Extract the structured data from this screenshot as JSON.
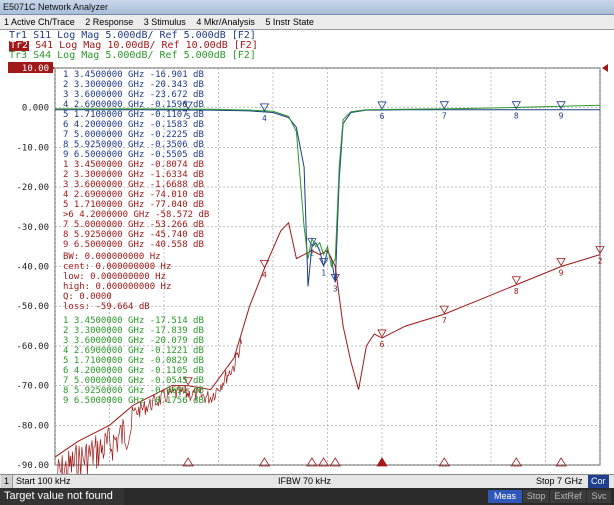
{
  "app_title": "E5071C Network Analyzer",
  "menu": [
    "1 Active Ch/Trace",
    "2 Response",
    "3 Stimulus",
    "4 Mkr/Analysis",
    "5 Instr State"
  ],
  "traces": [
    {
      "id": "Tr1",
      "text": "Tr1 S11 Log Mag 5.000dB/ Ref 5.000dB [F2]",
      "color": "#1e3a8a"
    },
    {
      "id": "Tr2",
      "text": "Tr2 S41 Log Mag 10.00dB/ Ref 10.00dB [F2]",
      "color": "#a01818"
    },
    {
      "id": "Tr3",
      "text": "Tr3 S44 Log Mag 5.000dB/ Ref 5.000dB [F2]",
      "color": "#2a9a2a"
    }
  ],
  "chart_data": {
    "type": "line",
    "x_range_ghz": [
      0.0001,
      7
    ],
    "y_labels": [
      "10.00",
      "0.000",
      "-10.00",
      "-20.00",
      "-30.00",
      "-40.00",
      "-50.00",
      "-60.00",
      "-70.00",
      "-80.00",
      "-90.00"
    ],
    "y_range_db": [
      -90,
      10
    ],
    "grid": true,
    "series": [
      {
        "name": "Tr1",
        "color": "#1e3a8a",
        "x": [
          0.0001,
          1.0,
          2.0,
          2.5,
          2.8,
          3.0,
          3.1,
          3.2,
          3.25,
          3.3,
          3.35,
          3.4,
          3.45,
          3.5,
          3.55,
          3.6,
          3.65,
          3.7,
          3.8,
          4.0,
          4.5,
          5.0,
          6.0,
          7.0
        ],
        "y": [
          -0.5,
          -0.5,
          -0.6,
          -0.8,
          -1.2,
          -2.5,
          -5,
          -15,
          -45,
          -35,
          -34,
          -36,
          -40,
          -36,
          -38,
          -44,
          -18,
          -4,
          -1.2,
          -0.6,
          -0.5,
          -0.5,
          -0.5,
          -0.5
        ]
      },
      {
        "name": "Tr2",
        "color": "#a01818",
        "x": [
          0.0001,
          0.3,
          0.7,
          1.0,
          1.5,
          1.7,
          2.0,
          2.3,
          2.5,
          2.7,
          2.9,
          3.0,
          3.1,
          3.2,
          3.3,
          3.4,
          3.5,
          3.6,
          3.7,
          3.8,
          3.9,
          4.0,
          4.1,
          4.2,
          4.5,
          5.0,
          5.5,
          6.0,
          6.5,
          7.0
        ],
        "y": [
          -88,
          -84,
          -80,
          -75,
          -70,
          -70,
          -71,
          -63,
          -50,
          -40,
          -31,
          -29,
          -38,
          -37,
          -36,
          -37,
          -36,
          -40,
          -55,
          -64,
          -71,
          -60,
          -57,
          -58,
          -55,
          -52,
          -48,
          -44,
          -40,
          -37
        ]
      },
      {
        "name": "Tr3",
        "color": "#2a9a2a",
        "x": [
          0.0001,
          1.0,
          2.0,
          2.5,
          2.8,
          3.0,
          3.1,
          3.2,
          3.25,
          3.3,
          3.35,
          3.4,
          3.45,
          3.5,
          3.55,
          3.6,
          3.65,
          3.7,
          3.8,
          4.0,
          4.5,
          5.0,
          6.0,
          7.0
        ],
        "y": [
          -0.3,
          -0.3,
          -0.4,
          -0.6,
          -0.9,
          -2.2,
          -6,
          -30,
          -38,
          -33,
          -35,
          -34,
          -37,
          -35,
          -40,
          -38,
          -15,
          -3,
          -1.0,
          -0.5,
          -0.4,
          -0.3,
          0.1,
          0.6
        ]
      }
    ]
  },
  "marker_table_blue": [
    "1  3.4500000 GHz -16.901 dB",
    "2  3.3000000 GHz -20.343 dB",
    "3  3.6000000 GHz -23.672 dB",
    "4  2.6900000 GHz -0.1596 dB",
    "5  1.7100000 GHz -0.1107 dB",
    "6  4.2000000 GHz -0.1583 dB",
    "7  5.0000000 GHz -0.2225 dB",
    "8  5.9250000 GHz -0.3506 dB",
    "9  6.5000000 GHz -0.5505 dB"
  ],
  "marker_table_red": [
    "1  3.4500000 GHz -0.8074 dB",
    "2  3.3000000 GHz -1.6334 dB",
    "3  3.6000000 GHz -1.6688 dB",
    "4  2.6900000 GHz -74.010 dB",
    "5  1.7100000 GHz -77.040 dB",
    ">6 4.2000000 GHz -58.572 dB",
    "7  5.0000000 GHz -53.266 dB",
    "8  5.9250000 GHz -45.740 dB",
    "9  6.5000000 GHz -40.558 dB"
  ],
  "bandwidth_stats": [
    "BW:  0.000000000 Hz",
    "cent: 0.000000000 Hz",
    "low:  0.000000000 Hz",
    "high: 0.000000000 Hz",
    "Q:   0.0000",
    "loss: -59.664 dB"
  ],
  "marker_table_green": [
    "1  3.4500000 GHz -17.514 dB",
    "2  3.3000000 GHz -17.839 dB",
    "3  3.6000000 GHz -20.079 dB",
    "4  2.6900000 GHz -0.1221 dB",
    "5  1.7100000 GHz -0.0829 dB",
    "6  4.2000000 GHz -0.1105 dB",
    "7  5.0000000 GHz -0.0545 dB",
    "8  5.9250000 GHz -0.0691 dB",
    "9  6.5000000 GHz -0.1756 dB"
  ],
  "markers": [
    {
      "label": "1",
      "x": 3.45,
      "series": "Tr1"
    },
    {
      "label": "2",
      "x": 3.3,
      "series": "Tr1"
    },
    {
      "label": "3",
      "x": 3.6,
      "series": "Tr1"
    },
    {
      "label": "4",
      "x": 2.69,
      "series": "Tr1"
    },
    {
      "label": "5",
      "x": 1.71,
      "series": "Tr1"
    },
    {
      "label": "6",
      "x": 4.2,
      "series": "Tr1"
    },
    {
      "label": "7",
      "x": 5.0,
      "series": "Tr1"
    },
    {
      "label": "8",
      "x": 5.925,
      "series": "Tr1"
    },
    {
      "label": "9",
      "x": 6.5,
      "series": "Tr1"
    },
    {
      "label": "2",
      "x": 7.0,
      "series": "Tr2"
    },
    {
      "label": "9",
      "x": 6.5,
      "series": "Tr2"
    },
    {
      "label": "8",
      "x": 5.925,
      "series": "Tr2"
    },
    {
      "label": "7",
      "x": 5.0,
      "series": "Tr2"
    },
    {
      "label": "6",
      "x": 4.2,
      "series": "Tr2"
    },
    {
      "label": "4",
      "x": 2.69,
      "series": "Tr2"
    },
    {
      "label": "5",
      "x": 1.71,
      "series": "Tr2"
    }
  ],
  "status": {
    "channel": "1",
    "start": "Start 100 kHz",
    "ifbw": "IFBW 70 kHz",
    "stop": "Stop 7 GHz",
    "cor": "Cor"
  },
  "bottom": {
    "message": "Target value not found",
    "meas": "Meas",
    "stop": "Stop",
    "extref": "ExtRef",
    "svc": "Svc"
  }
}
